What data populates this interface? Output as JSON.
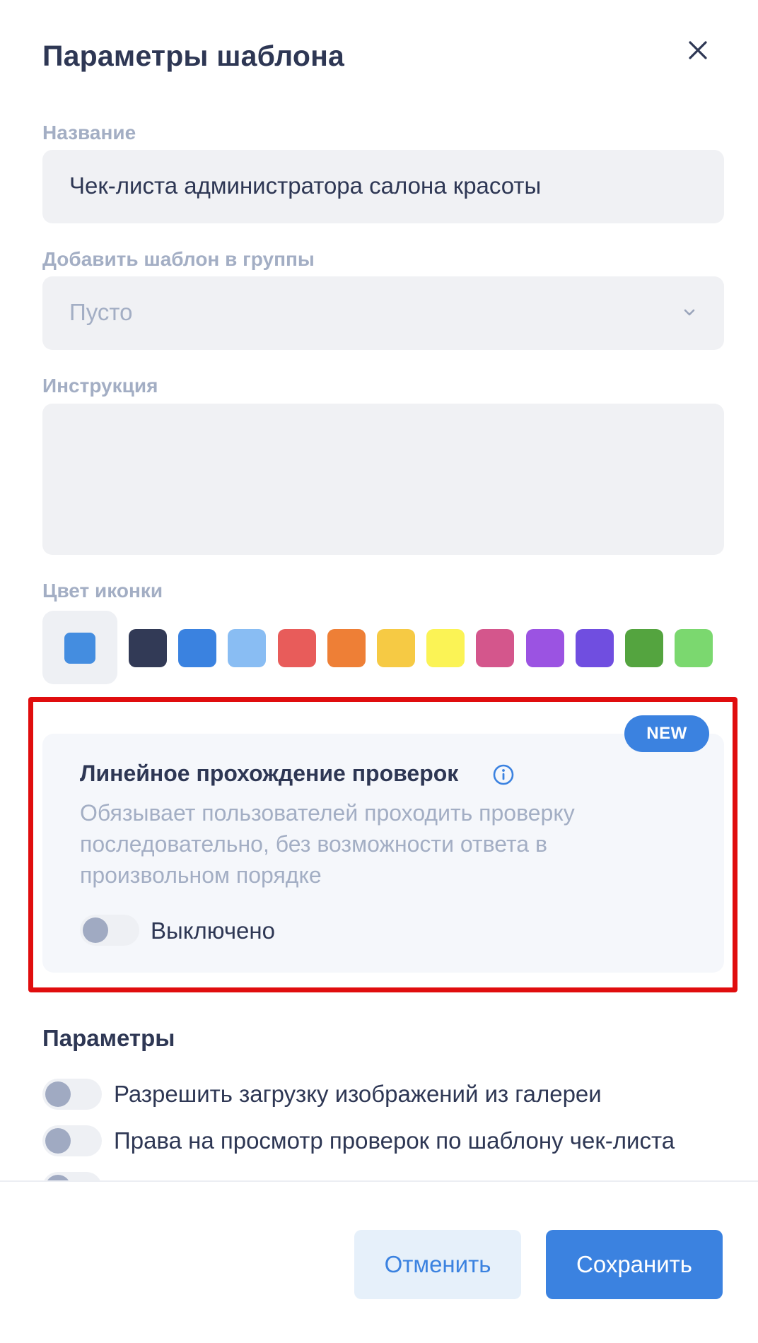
{
  "modal": {
    "title": "Параметры шаблона",
    "close_icon": "close-icon"
  },
  "name_field": {
    "label": "Название",
    "value": "Чек-листа администратора салона красоты"
  },
  "groups_field": {
    "label": "Добавить шаблон в группы",
    "placeholder": "Пусто",
    "chevron_icon": "chevron-down-icon"
  },
  "instruction_field": {
    "label": "Инструкция",
    "value": ""
  },
  "icon_color": {
    "label": "Цвет иконки",
    "selected": "#448de0",
    "options": [
      "#323a56",
      "#3a82e0",
      "#89bdf3",
      "#e85c5a",
      "#ee7f36",
      "#f6ca44",
      "#fbf355",
      "#d4568c",
      "#9b53e2",
      "#704ee0",
      "#54a43f",
      "#7bd86f"
    ]
  },
  "linear_pass": {
    "badge": "NEW",
    "title": "Линейное прохождение проверок",
    "info_icon": "info-icon",
    "description": "Обязывает пользователей проходить проверку последовательно, без возможности ответа в произвольном порядке",
    "toggle_label": "Выключено",
    "enabled": false
  },
  "params": {
    "title": "Параметры",
    "items": [
      {
        "label": "Разрешить загрузку изображений из галереи",
        "enabled": false
      },
      {
        "label": "Права на просмотр проверок по шаблону чек-листа",
        "enabled": false
      }
    ]
  },
  "footer": {
    "cancel_label": "Отменить",
    "save_label": "Сохранить"
  },
  "colors": {
    "accent": "#3b82e0",
    "highlight": "#e00d0e"
  }
}
